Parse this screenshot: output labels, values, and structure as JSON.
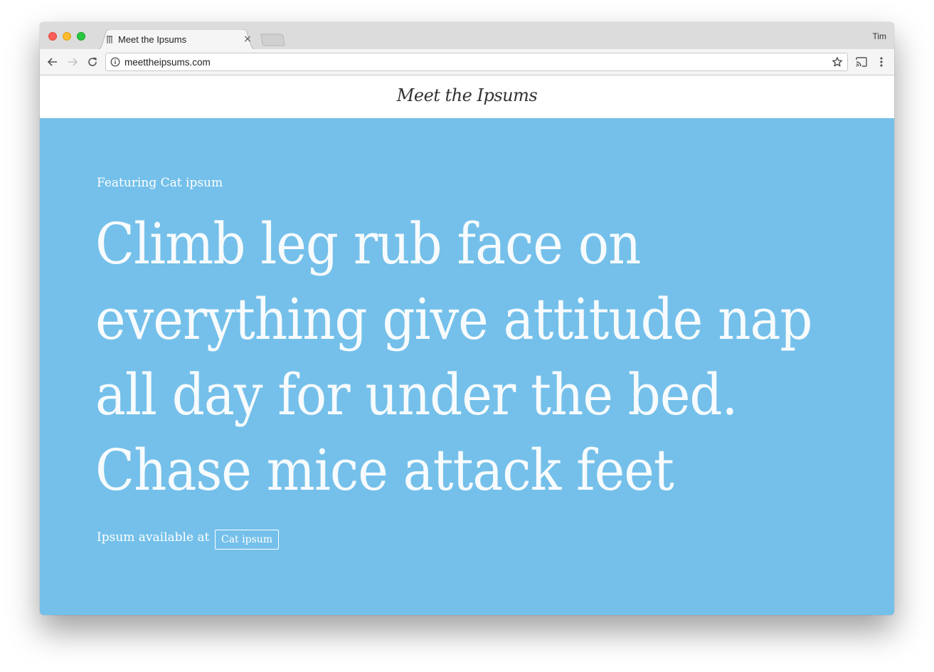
{
  "browser": {
    "tab_title": "Meet the Ipsums",
    "tab_close_glyph": "×",
    "profile_name": "Tim",
    "url": "meettheipsums.com"
  },
  "colors": {
    "hero_background": "#74c0ea",
    "header_background": "#ffffff"
  },
  "page": {
    "logo": "Meet the Ipsums",
    "featuring": "Featuring Cat ipsum",
    "quote": "Climb leg rub face on everything give attitude nap all day for under the bed. Chase mice attack feet",
    "available_label": "Ipsum available at",
    "source_tag": "Cat ipsum"
  }
}
